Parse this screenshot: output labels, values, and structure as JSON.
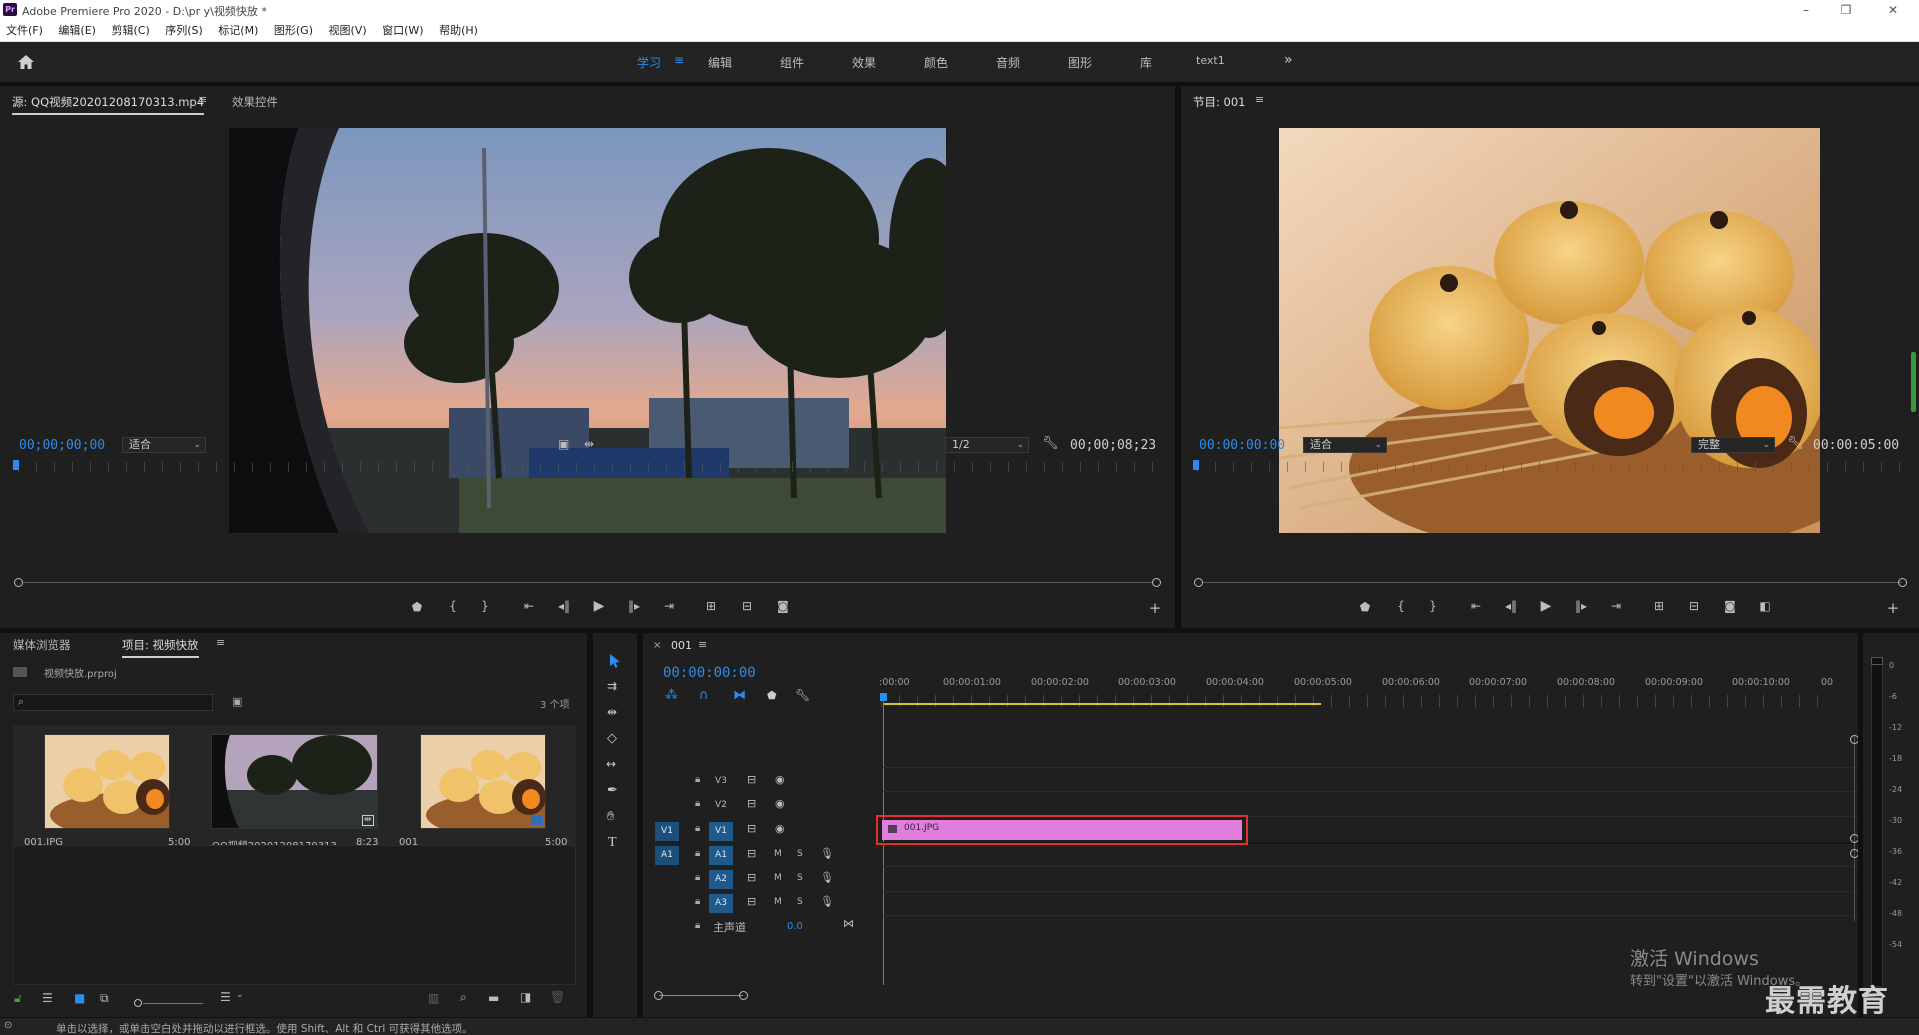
{
  "window": {
    "title": "Adobe Premiere Pro 2020 - D:\\pr y\\视频快放 *",
    "app_icon_text": "Pr",
    "controls": {
      "minimize": "–",
      "restore": "❐",
      "close": "✕"
    }
  },
  "menu": [
    "文件(F)",
    "编辑(E)",
    "剪辑(C)",
    "序列(S)",
    "标记(M)",
    "图形(G)",
    "视图(V)",
    "窗口(W)",
    "帮助(H)"
  ],
  "workspaces": {
    "tabs": [
      "学习",
      "编辑",
      "组件",
      "效果",
      "颜色",
      "音频",
      "图形",
      "库",
      "text1"
    ],
    "active": "学习",
    "more": "»"
  },
  "source_monitor": {
    "tabs": [
      "源: QQ视频20201208170313.mp4",
      "效果控件"
    ],
    "timecode": "00;00;00;00",
    "zoom": "适合",
    "resolution": "1/2",
    "duration": "00;00;08;23"
  },
  "program_monitor": {
    "tab": "节目: 001",
    "timecode": "00:00:00:00",
    "zoom": "适合",
    "quality": "完整",
    "duration": "00:00:05:00"
  },
  "project_panel": {
    "tabs": [
      "媒体浏览器",
      "项目: 视频快放"
    ],
    "project_file": "视频快放.prproj",
    "item_count": "3 个项",
    "items": [
      {
        "name": "001.JPG",
        "duration": "5:00"
      },
      {
        "name": "QQ视频20201208170313...",
        "duration": "8;23"
      },
      {
        "name": "001",
        "duration": "5:00"
      }
    ]
  },
  "timeline": {
    "sequence_tab": "001",
    "close_glyph": "×",
    "timecode": "00:00:00:00",
    "ruler": [
      ":00:00",
      "00:00:01:00",
      "00:00:02:00",
      "00:00:03:00",
      "00:00:04:00",
      "00:00:05:00",
      "00:00:06:00",
      "00:00:07:00",
      "00:00:08:00",
      "00:00:09:00",
      "00:00:10:00",
      "00"
    ],
    "video_tracks": [
      "V3",
      "V2",
      "V1"
    ],
    "audio_tracks": [
      "A1",
      "A2",
      "A3"
    ],
    "source_v": "V1",
    "source_a": "A1",
    "mute": "M",
    "solo": "S",
    "master_label": "主声道",
    "master_value": "0.0",
    "clip_name": "001.JPG"
  },
  "audio_meter": {
    "labels": [
      "0",
      "-6",
      "-12",
      "-18",
      "-24",
      "-30",
      "-36",
      "-42",
      "-48",
      "-54"
    ]
  },
  "status_bar": "单击以选择，或单击空白处并拖动以进行框选。使用 Shift、Alt 和 Ctrl 可获得其他选项。",
  "watermark": {
    "activate_title": "激活 Windows",
    "activate_sub": "转到\"设置\"以激活 Windows。",
    "brand": "最需教育"
  },
  "colors": {
    "accent_blue": "#2d8ceb",
    "clip_pink": "#e07fdb",
    "highlight_red": "#e03030",
    "work_area_yellow": "#d8c33a"
  }
}
